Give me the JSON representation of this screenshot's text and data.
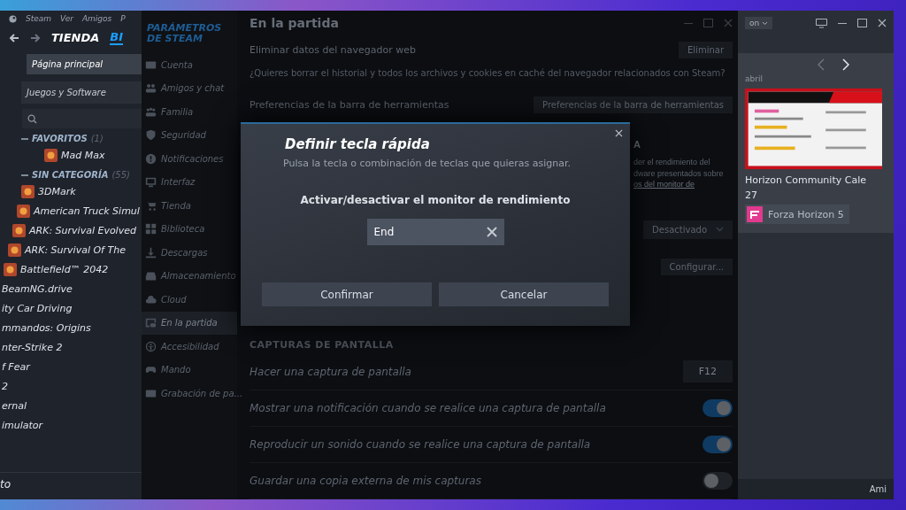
{
  "library": {
    "menu": [
      "Steam",
      "Ver",
      "Amigos",
      "P"
    ],
    "nav": [
      {
        "label": "TIENDA",
        "selected": false
      },
      {
        "label": "BI",
        "selected": true
      }
    ],
    "home": "Página principal",
    "filter": "Juegos y Software",
    "groups": [
      {
        "name": "FAVORITOS",
        "count": "(1)",
        "expanded": true,
        "games": [
          {
            "title": "Mad Max",
            "has_icon": true
          }
        ]
      },
      {
        "name": "SIN CATEGORÍA",
        "count": "(55)",
        "expanded": true,
        "games": [
          {
            "title": "3DMark",
            "has_icon": true
          },
          {
            "title": "American Truck Simul",
            "has_icon": true
          },
          {
            "title": "ARK: Survival Evolved",
            "has_icon": true
          },
          {
            "title": "ARK: Survival Of The",
            "has_icon": true
          },
          {
            "title": "Battlefield™ 2042",
            "has_icon": true
          },
          {
            "title": "BeamNG.drive",
            "has_icon": false
          },
          {
            "title": "ity Car Driving",
            "has_icon": false
          },
          {
            "title": "mmandos: Origins",
            "has_icon": false
          },
          {
            "title": "nter-Strike 2",
            "has_icon": false
          },
          {
            "title": "f Fear",
            "has_icon": false
          },
          {
            "title": "2",
            "has_icon": false
          },
          {
            "title": "ernal",
            "has_icon": false
          },
          {
            "title": "imulator",
            "has_icon": false
          }
        ]
      }
    ],
    "footer": "to"
  },
  "settings": {
    "title": "PARÁMETROS DE STEAM",
    "nav": [
      {
        "label": "Cuenta",
        "selected": false
      },
      {
        "label": "Amigos y chat",
        "selected": false
      },
      {
        "label": "Familia",
        "selected": false
      },
      {
        "label": "Seguridad",
        "selected": false
      },
      {
        "label": "Notificaciones",
        "selected": false
      },
      {
        "label": "Interfaz",
        "selected": false
      },
      {
        "label": "Tienda",
        "selected": false
      },
      {
        "label": "Biblioteca",
        "selected": false
      },
      {
        "label": "Descargas",
        "selected": false
      },
      {
        "label": "Almacenamiento",
        "selected": false
      },
      {
        "label": "Cloud",
        "selected": false
      },
      {
        "label": "En la partida",
        "selected": true
      },
      {
        "label": "Accesibilidad",
        "selected": false
      },
      {
        "label": "Mando",
        "selected": false
      },
      {
        "label": "Grabación de pa...",
        "selected": false
      }
    ],
    "page_title": "En la partida",
    "rows": [
      {
        "kind": "button",
        "label": "Eliminar datos del navegador web",
        "button": "Eliminar"
      },
      {
        "kind": "description",
        "text": "¿Quieres borrar el historial y todos los archivos y cookies en caché del navegador relacionados con Steam?"
      },
      {
        "kind": "button",
        "label": "Preferencias de la barra de herramientas",
        "button": "Preferencias de la barra de herramientas"
      },
      {
        "kind": "partial",
        "heading": "A",
        "lines": [
          "der el rendimiento del",
          "dware presentados sobre"
        ],
        "link": "os del monitor de"
      },
      {
        "kind": "dropdown",
        "value": "Desactivado"
      },
      {
        "kind": "action",
        "button": "Configurar..."
      },
      {
        "kind": "section",
        "text": "CAPTURAS DE PANTALLA"
      },
      {
        "kind": "hotkey",
        "label": "Hacer una captura de pantalla",
        "value": "F12"
      },
      {
        "kind": "toggle",
        "label": "Mostrar una notificación cuando se realice una captura de pantalla",
        "on": true
      },
      {
        "kind": "toggle",
        "label": "Reproducir un sonido cuando se realice una captura de pantalla",
        "on": true
      },
      {
        "kind": "toggle",
        "label": "Guardar una copia externa de mis capturas",
        "on": false
      }
    ]
  },
  "store": {
    "account": "on",
    "month": "abril",
    "event_title": "Horizon Community Cale",
    "event_day": "27",
    "game_tag": "Forza Horizon 5",
    "footer": "Ami"
  },
  "dialog": {
    "title": "Definir tecla rápida",
    "subtitle": "Pulsa la tecla o combinación de teclas que quieras asignar.",
    "action": "Activar/desactivar el monitor de rendimiento",
    "value": "End",
    "buttons": [
      "Confirmar",
      "Cancelar"
    ]
  }
}
